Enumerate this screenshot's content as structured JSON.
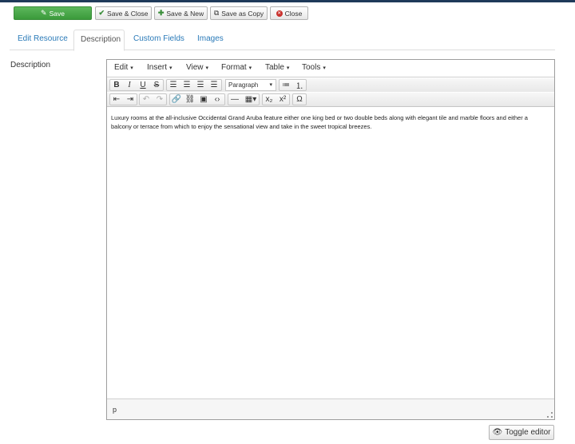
{
  "toolbar": {
    "save": "Save",
    "save_close": "Save & Close",
    "save_new": "Save & New",
    "save_copy": "Save as Copy",
    "close": "Close"
  },
  "tabs": [
    {
      "label": "Edit Resource"
    },
    {
      "label": "Description",
      "active": true
    },
    {
      "label": "Custom Fields"
    },
    {
      "label": "Images"
    }
  ],
  "field": {
    "label": "Description"
  },
  "editor": {
    "menus": [
      "Edit",
      "Insert",
      "View",
      "Format",
      "Table",
      "Tools"
    ],
    "format_select": "Paragraph",
    "content": "Luxury rooms at the all-inclusive Occidental Grand Aruba feature either one king bed or two double beds along with elegant tile and marble floors and either a balcony or terrace from which to enjoy the sensational view and take in the sweet tropical breezes.",
    "path": "p"
  },
  "toggle_editor": "Toggle editor",
  "colors": {
    "accent_link": "#2a7ab8",
    "save_green": "#3b9a3b",
    "close_red": "#c9302c"
  }
}
